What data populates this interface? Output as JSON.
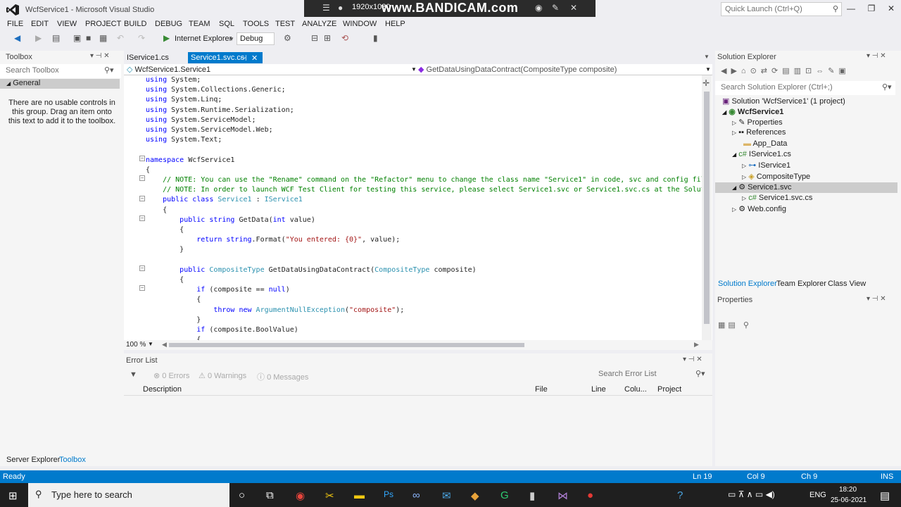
{
  "window": {
    "title": "WcfService1 - Microsoft Visual Studio"
  },
  "overlay": {
    "resolution": "1920x1080",
    "brand": "www.BANDICAM.com"
  },
  "quick_launch": {
    "placeholder": "Quick Launch (Ctrl+Q)"
  },
  "menu": [
    "FILE",
    "EDIT",
    "VIEW",
    "PROJECT",
    "BUILD",
    "DEBUG",
    "TEAM",
    "SQL",
    "TOOLS",
    "TEST",
    "ANALYZE",
    "WINDOW",
    "HELP"
  ],
  "toolbar": {
    "browser": "Internet Explorer",
    "config": "Debug"
  },
  "toolbox": {
    "title": "Toolbox",
    "search_placeholder": "Search Toolbox",
    "group": "General",
    "note": "There are no usable controls in this group. Drag an item onto this text to add it to the toolbox.",
    "bottom_tabs": [
      "Server Explorer",
      "Toolbox"
    ]
  },
  "editor": {
    "tabs": [
      "IService1.cs",
      "Service1.svc.cs"
    ],
    "nav_left": "WcfService1.Service1",
    "nav_right": "GetDataUsingDataContract(CompositeType composite)",
    "zoom": "100 %"
  },
  "error_list": {
    "title": "Error List",
    "errors": "0 Errors",
    "warnings": "0 Warnings",
    "messages": "0 Messages",
    "search_placeholder": "Search Error List",
    "columns": [
      "Description",
      "File",
      "Line",
      "Colu...",
      "Project"
    ]
  },
  "solution_explorer": {
    "title": "Solution Explorer",
    "search_placeholder": "Search Solution Explorer (Ctrl+;)",
    "items": [
      "Solution 'WcfService1' (1 project)",
      "WcfService1",
      "Properties",
      "References",
      "App_Data",
      "IService1.cs",
      "IService1",
      "CompositeType",
      "Service1.svc",
      "Service1.svc.cs",
      "Web.config"
    ],
    "tabs": [
      "Solution Explorer",
      "Team Explorer",
      "Class View"
    ],
    "properties_title": "Properties"
  },
  "status": {
    "ready": "Ready",
    "ln": "Ln 19",
    "col": "Col 9",
    "ch": "Ch 9",
    "ins": "INS"
  },
  "taskbar": {
    "search": "Type here to search",
    "lang": "ENG",
    "time": "18:20",
    "date": "25-06-2021"
  },
  "colors": {
    "accent": "#007acc",
    "keyword": "#0000ff",
    "type": "#2b91af",
    "comment": "#008000",
    "string": "#a31515"
  }
}
